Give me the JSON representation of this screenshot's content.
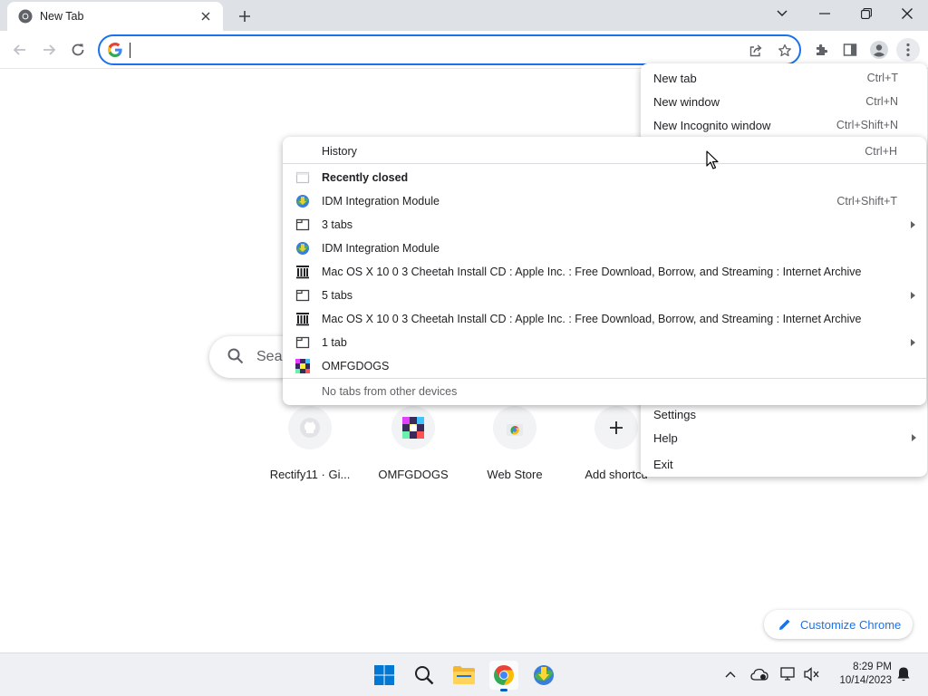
{
  "browser": {
    "tab_title": "New Tab",
    "omnibox_value": ""
  },
  "ntp": {
    "search_placeholder": "Sear",
    "shortcuts": [
      "Rectify11 · Gi...",
      "OMFGDOGS",
      "Web Store",
      "Add shortcu"
    ],
    "customize_label": "Customize Chrome"
  },
  "main_menu": {
    "items": [
      {
        "label": "New tab",
        "shortcut": "Ctrl+T"
      },
      {
        "label": "New window",
        "shortcut": "Ctrl+N"
      },
      {
        "label": "New Incognito window",
        "shortcut": "Ctrl+Shift+N"
      },
      {
        "label": "Settings",
        "shortcut": ""
      },
      {
        "label": "Help",
        "shortcut": ""
      },
      {
        "label": "Exit",
        "shortcut": ""
      }
    ]
  },
  "history_menu": {
    "history": {
      "label": "History",
      "shortcut": "Ctrl+H"
    },
    "recently_closed": "Recently closed",
    "entries": [
      {
        "label": "IDM Integration Module",
        "shortcut": "Ctrl+Shift+T",
        "icon": "idm-icon"
      },
      {
        "label": "3 tabs",
        "shortcut": "",
        "icon": "tabs-folder-icon"
      },
      {
        "label": "IDM Integration Module",
        "shortcut": "",
        "icon": "idm-icon"
      },
      {
        "label": "Mac OS X 10 0 3 Cheetah Install CD : Apple Inc. : Free Download, Borrow, and Streaming : Internet Archive",
        "shortcut": "",
        "icon": "internet-archive-icon"
      },
      {
        "label": "5 tabs",
        "shortcut": "",
        "icon": "tabs-folder-icon"
      },
      {
        "label": "Mac OS X 10 0 3 Cheetah Install CD : Apple Inc. : Free Download, Borrow, and Streaming : Internet Archive",
        "shortcut": "",
        "icon": "internet-archive-icon"
      },
      {
        "label": "1 tab",
        "shortcut": "",
        "icon": "tabs-folder-icon"
      },
      {
        "label": "OMFGDOGS",
        "shortcut": "",
        "icon": "omfgdogs-icon"
      }
    ],
    "no_devices": "No tabs from other devices"
  },
  "taskbar": {
    "time": "8:29 PM",
    "date": "10/14/2023"
  },
  "colors": {
    "accent": "#1a73e8",
    "titlebar": "#dee1e6",
    "taskbar": "#eef0f3"
  }
}
